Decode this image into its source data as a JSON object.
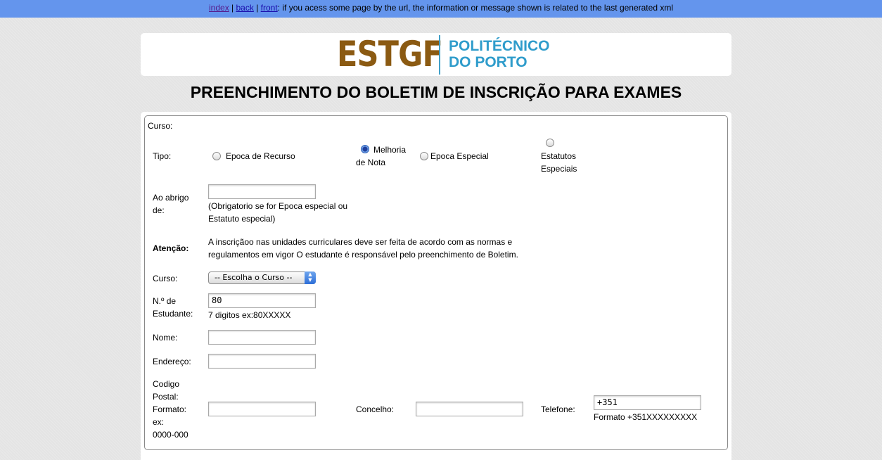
{
  "topbar": {
    "links": [
      "index",
      "back",
      "front"
    ],
    "separator": "|",
    "message": ": if you acess some page by the url, the information or message shown is related to the last generated xml"
  },
  "logo": {
    "estgf": "ESTGF",
    "line1": "POLITÉCNICO",
    "line2": "DO PORTO"
  },
  "page_title": "PREENCHIMENTO DO BOLETIM DE INSCRIÇÃO PARA EXAMES",
  "form": {
    "curso_header": "Curso:",
    "tipo_label": "Tipo:",
    "tipo_options": [
      {
        "line1": "Epoca de Recurso",
        "line2": "",
        "checked": false
      },
      {
        "line1": "Melhoria",
        "line2": "de Nota",
        "checked": true
      },
      {
        "line1": "Epoca Especial",
        "line2": "",
        "checked": false
      },
      {
        "line1": "Estatutos",
        "line2": "Especiais",
        "checked": false
      }
    ],
    "abrigo_label": [
      "Ao abrigo",
      "de:"
    ],
    "abrigo_value": "",
    "abrigo_hint": [
      "(Obrigatorio se for Epoca especial ou",
      "Estatuto especial)"
    ],
    "atencao_label": "Atenção:",
    "atencao_text": [
      "A inscriçãoo nas unidades curriculares deve ser feita de acordo com as normas e",
      "regulamentos em vigor O estudante é responsável pelo preenchimento de Boletim."
    ],
    "curso_label": "Curso:",
    "curso_select": "-- Escolha o Curso --",
    "estudante_label": [
      "N.º de",
      "Estudante:"
    ],
    "estudante_value": "80",
    "estudante_hint": "7 digitos ex:80XXXXX",
    "nome_label": "Nome:",
    "nome_value": "",
    "endereco_label": "Endereço:",
    "endereco_value": "",
    "codigo_label": [
      "Codigo",
      "Postal:",
      "Formato:",
      "ex:",
      "0000-000"
    ],
    "codigo_value": "",
    "concelho_label": "Concelho:",
    "concelho_value": "",
    "telefone_label": "Telefone:",
    "telefone_value": "+351",
    "telefone_hint": "Formato +351XXXXXXXXX"
  },
  "colors": {
    "topbar": "#6495ed",
    "logo_brown": "#8b5a12",
    "logo_blue": "#2f9ccb"
  }
}
